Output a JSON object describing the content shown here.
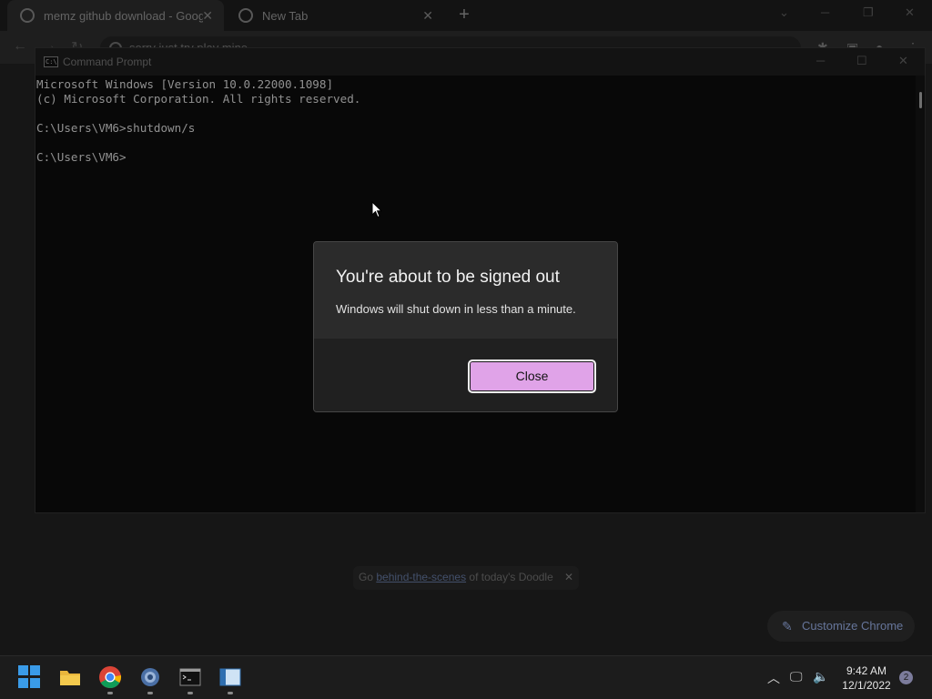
{
  "browser": {
    "tabs": [
      {
        "title": "memz github download - Google"
      },
      {
        "title": "New Tab"
      }
    ],
    "new_tab_label": "+",
    "omnibox_text": "sorry just try play mine",
    "doodle": {
      "prefix": "Go ",
      "link": "behind-the-scenes",
      "suffix": " of today's Doodle",
      "close": "✕"
    },
    "customize_label": "Customize Chrome"
  },
  "cmd": {
    "title": "Command Prompt",
    "lines": [
      "Microsoft Windows [Version 10.0.22000.1098]",
      "(c) Microsoft Corporation. All rights reserved.",
      "",
      "C:\\Users\\VM6>shutdown/s",
      "",
      "C:\\Users\\VM6>"
    ]
  },
  "dialog": {
    "title": "You're about to be signed out",
    "message": "Windows will shut down in less than a minute.",
    "close_label": "Close",
    "accent_color": "#e0a3e8"
  },
  "taskbar": {
    "apps": [
      "start-icon",
      "file-explorer-icon",
      "chrome-icon",
      "settings-icon",
      "command-prompt-icon",
      "window-app-icon"
    ],
    "time": "9:42 AM",
    "date": "12/1/2022",
    "notification_count": "2"
  }
}
